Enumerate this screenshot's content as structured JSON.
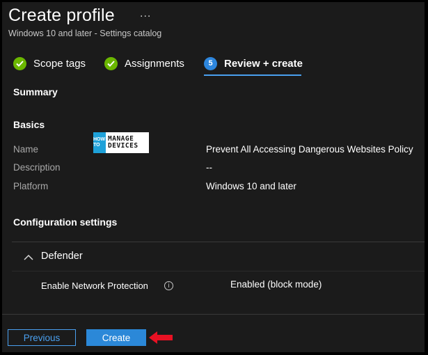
{
  "header": {
    "title": "Create profile",
    "more": "...",
    "subtitle": "Windows 10 and later - Settings catalog"
  },
  "steps": [
    {
      "label": "Scope tags",
      "state": "done"
    },
    {
      "label": "Assignments",
      "state": "done"
    },
    {
      "label": "Review + create",
      "state": "active",
      "number": "5"
    }
  ],
  "summary": {
    "heading": "Summary"
  },
  "basics": {
    "heading": "Basics",
    "rows": [
      {
        "key": "Name",
        "value": "Prevent All Accessing Dangerous Websites Policy"
      },
      {
        "key": "Description",
        "value": "--"
      },
      {
        "key": "Platform",
        "value": "Windows 10 and later"
      }
    ]
  },
  "watermark": {
    "how": "HOW TO",
    "line1": "MANAGE",
    "line2": "DEVICES"
  },
  "config": {
    "heading": "Configuration settings",
    "group": "Defender",
    "setting_label": "Enable Network Protection",
    "setting_value": "Enabled (block mode)"
  },
  "footer": {
    "previous_label": "Previous",
    "create_label": "Create"
  },
  "colors": {
    "background": "#1b1b1b",
    "accent": "#2b88d8",
    "check": "#6bb700",
    "arrow": "#e81123"
  }
}
